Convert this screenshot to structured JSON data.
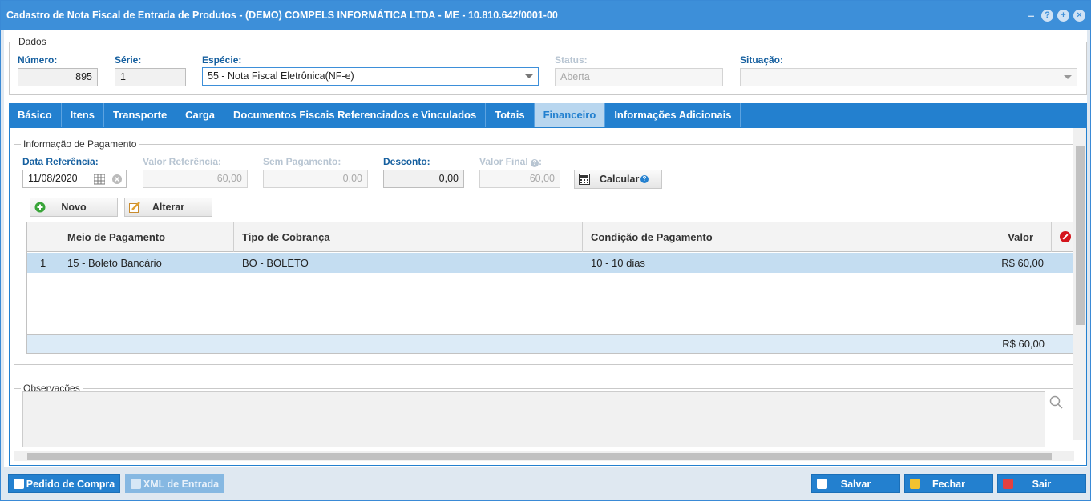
{
  "window": {
    "title": "Cadastro de Nota Fiscal de Entrada de Produtos - (DEMO) COMPELS INFORMÁTICA LTDA - ME - 10.810.642/0001-00",
    "tools": [
      "minimize-icon",
      "help-icon",
      "maximize-icon",
      "close-icon"
    ]
  },
  "dados": {
    "legend": "Dados",
    "numero_label": "Número:",
    "numero_value": "895",
    "serie_label": "Série:",
    "serie_value": "1",
    "especie_label": "Espécie:",
    "especie_value": "55 - Nota Fiscal Eletrônica(NF-e)",
    "status_label": "Status:",
    "status_value": "Aberta",
    "situacao_label": "Situação:",
    "situacao_value": ""
  },
  "tabs": [
    {
      "label": "Básico",
      "active": false
    },
    {
      "label": "Itens",
      "active": false
    },
    {
      "label": "Transporte",
      "active": false
    },
    {
      "label": "Carga",
      "active": false
    },
    {
      "label": "Documentos Fiscais Referenciados e Vinculados",
      "active": false
    },
    {
      "label": "Totais",
      "active": false
    },
    {
      "label": "Financeiro",
      "active": true
    },
    {
      "label": "Informações Adicionais",
      "active": false
    }
  ],
  "pagamento": {
    "legend": "Informação de Pagamento",
    "data_ref_label": "Data Referência:",
    "data_ref_value": "11/08/2020",
    "valor_ref_label": "Valor Referência:",
    "valor_ref_value": "60,00",
    "sem_pag_label": "Sem Pagamento:",
    "sem_pag_value": "0,00",
    "desconto_label": "Desconto:",
    "desconto_value": "0,00",
    "valor_final_label": "Valor Final",
    "valor_final_value": "60,00",
    "calcular_label": "Calcular",
    "novo_label": "Novo",
    "alterar_label": "Alterar"
  },
  "grid": {
    "columns": [
      "",
      "Meio de Pagamento",
      "Tipo de Cobrança",
      "Condição de Pagamento",
      "Valor"
    ],
    "rows": [
      {
        "n": "1",
        "meio": "15 - Boleto Bancário",
        "tipo": "BO - BOLETO",
        "condicao": "10 - 10 dias",
        "valor": "R$ 60,00"
      }
    ],
    "total": "R$ 60,00"
  },
  "observacoes": {
    "legend": "Observações"
  },
  "footer": {
    "pedido_label": "Pedido de Compra",
    "xml_label": "XML de Entrada",
    "salvar_label": "Salvar",
    "fechar_label": "Fechar",
    "sair_label": "Sair"
  }
}
